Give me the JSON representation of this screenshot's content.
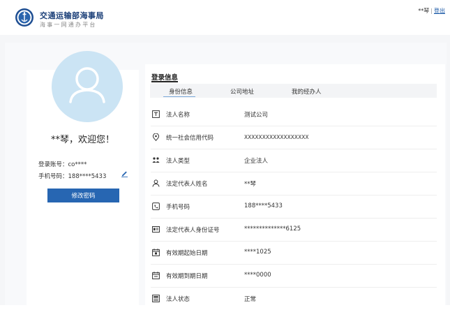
{
  "header": {
    "title": "交通运输部海事局",
    "subtitle": "海事一网通办平台",
    "user_name": "**琴",
    "separator": "|",
    "logout": "登出"
  },
  "profile": {
    "welcome": "**琴，欢迎您！",
    "account": "登录账号：co****",
    "phone": "手机号码：188****5433",
    "change_password": "修改密码"
  },
  "section_title": "登录信息",
  "tabs": [
    {
      "label": "身份信息",
      "active": true
    },
    {
      "label": "公司地址",
      "active": false
    },
    {
      "label": "我的经办人",
      "active": false
    }
  ],
  "fields": [
    {
      "icon": "name-card-icon",
      "label": "法人名称",
      "value": "测试公司"
    },
    {
      "icon": "location-pin-icon",
      "label": "统一社会信用代码",
      "value": "XXXXXXXXXXXXXXXXXX"
    },
    {
      "icon": "legal-person-type-icon",
      "label": "法人类型",
      "value": "企业法人"
    },
    {
      "icon": "person-icon",
      "label": "法定代表人姓名",
      "value": "**琴"
    },
    {
      "icon": "phone-icon",
      "label": "手机号码",
      "value": "188****5433"
    },
    {
      "icon": "id-card-icon",
      "label": "法定代表人身份证号",
      "value": "**************6125"
    },
    {
      "icon": "calendar-start-icon",
      "label": "有效期起始日期",
      "value": "****1025"
    },
    {
      "icon": "calendar-end-icon",
      "label": "有效期到期日期",
      "value": "****0000"
    },
    {
      "icon": "status-icon",
      "label": "法人状态",
      "value": "正常"
    }
  ],
  "colors": {
    "accent": "#2766b2",
    "avatar_bg": "#cbe4f4",
    "brand_text": "#1b3f78"
  }
}
